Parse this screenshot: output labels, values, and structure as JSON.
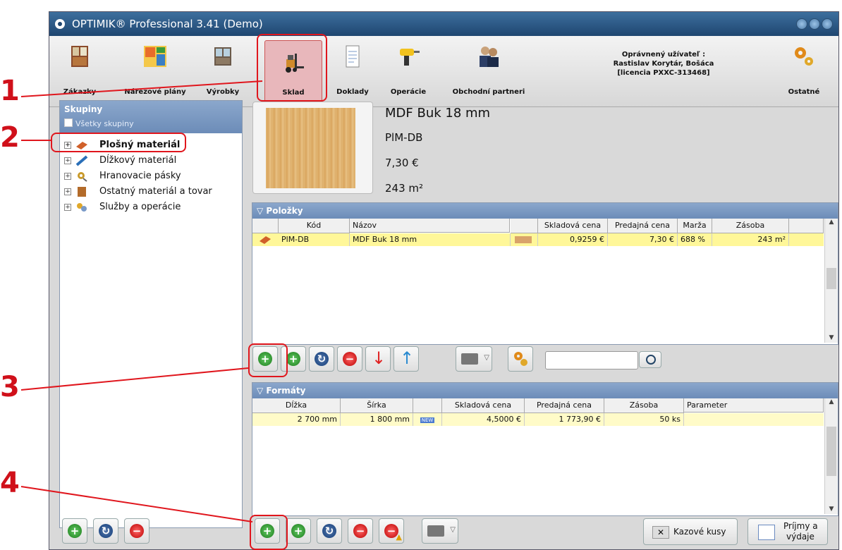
{
  "window": {
    "title": "OPTIMIK® Professional 3.41 (Demo)"
  },
  "toolbar": {
    "zakazky": "Zákazky",
    "narezove": "Nárezové plány",
    "vyrobky": "Výrobky",
    "sklad": "Sklad",
    "doklady": "Doklady",
    "operacie": "Operácie",
    "partneri": "Obchodní partneri",
    "ostatne": "Ostatné"
  },
  "user": {
    "line1": "Oprávnený užívateľ :",
    "line2": "Rastislav Korytár, Bošáca",
    "line3": "[licencia PXXC-313468]"
  },
  "groups": {
    "header": "Skupiny",
    "all": "Všetky skupiny",
    "items": [
      "Plošný materiál",
      "Dĺžkový materiál",
      "Hranovacie pásky",
      "Ostatný materiál a tovar",
      "Služby a operácie"
    ]
  },
  "product": {
    "name": "MDF Buk 18 mm",
    "code": "PlM-DB",
    "price": "7,30 €",
    "stock": "243 m²"
  },
  "items": {
    "header": "Položky",
    "columns": [
      "Kód",
      "Názov",
      "Skladová cena",
      "Predajná cena",
      "Marža",
      "Zásoba"
    ],
    "row": {
      "kod": "PlM-DB",
      "nazov": "MDF Buk 18 mm",
      "skladova": "0,9259 €",
      "predajna": "7,30 €",
      "marza": "688 %",
      "zasoba": "243 m²"
    }
  },
  "formats": {
    "header": "Formáty",
    "columns": [
      "Dĺžka",
      "Šírka",
      "Skladová cena",
      "Predajná cena",
      "Zásoba",
      "Parameter"
    ],
    "row": {
      "dlzka": "2 700 mm",
      "sirka": "1 800 mm",
      "badge": "NEW",
      "skladova": "4,5000 €",
      "predajna": "1 773,90 €",
      "zasoba": "50 ks"
    }
  },
  "bottom": {
    "kazove": "Kazové kusy",
    "prijmy1": "Príjmy a",
    "prijmy2": "výdaje"
  },
  "annotations": [
    "1",
    "2",
    "3",
    "4"
  ]
}
